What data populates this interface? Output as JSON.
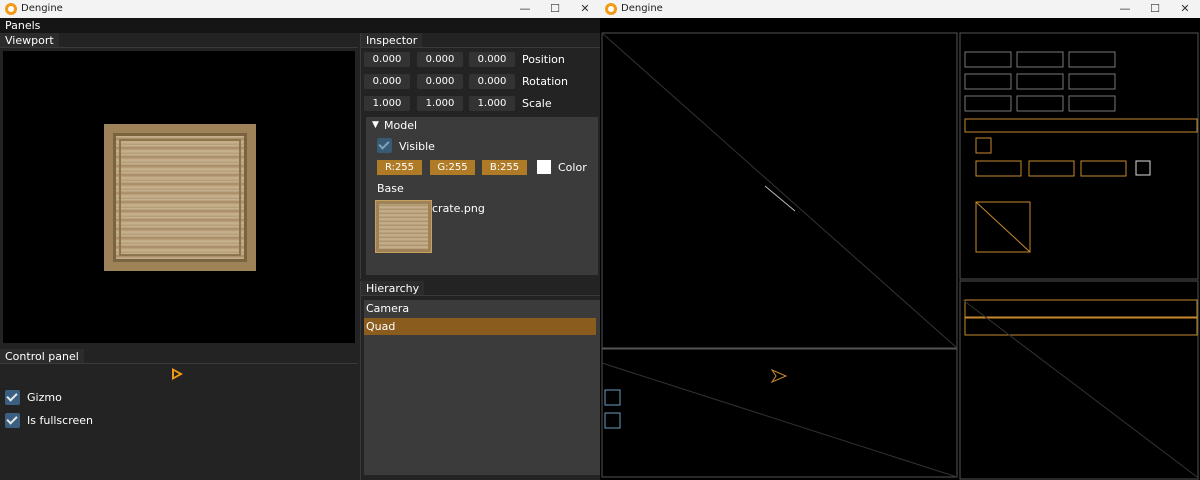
{
  "app": {
    "title": "Dengine",
    "window_controls": {
      "minimize": "—",
      "maximize": "☐",
      "close": "✕"
    }
  },
  "menubar": {
    "label": "Panels"
  },
  "viewport": {
    "tab": "Viewport"
  },
  "control_panel": {
    "tab": "Control panel",
    "play_icon": "play-icon",
    "options": [
      {
        "label": "Gizmo",
        "checked": true
      },
      {
        "label": "Is fullscreen",
        "checked": true
      }
    ]
  },
  "inspector": {
    "tab": "Inspector",
    "transform": [
      {
        "label": "Position",
        "values": [
          "0.000",
          "0.000",
          "0.000"
        ]
      },
      {
        "label": "Rotation",
        "values": [
          "0.000",
          "0.000",
          "0.000"
        ]
      },
      {
        "label": "Scale",
        "values": [
          "1.000",
          "1.000",
          "1.000"
        ]
      }
    ],
    "model": {
      "header": "Model",
      "visible_label": "Visible",
      "visible_checked": true,
      "color": {
        "r": "R:255",
        "g": "G:255",
        "b": "B:255",
        "label": "Color"
      },
      "base_label": "Base",
      "texture_name": "crate.png"
    }
  },
  "hierarchy": {
    "tab": "Hierarchy",
    "items": [
      {
        "label": "Camera",
        "selected": false
      },
      {
        "label": "Quad",
        "selected": true
      }
    ]
  },
  "colors": {
    "accent": "#f29a16",
    "selection": "#8a5d1f",
    "color_button": "#b07b26",
    "checkbox": "#3a5f80",
    "panel_bg": "#232323"
  }
}
